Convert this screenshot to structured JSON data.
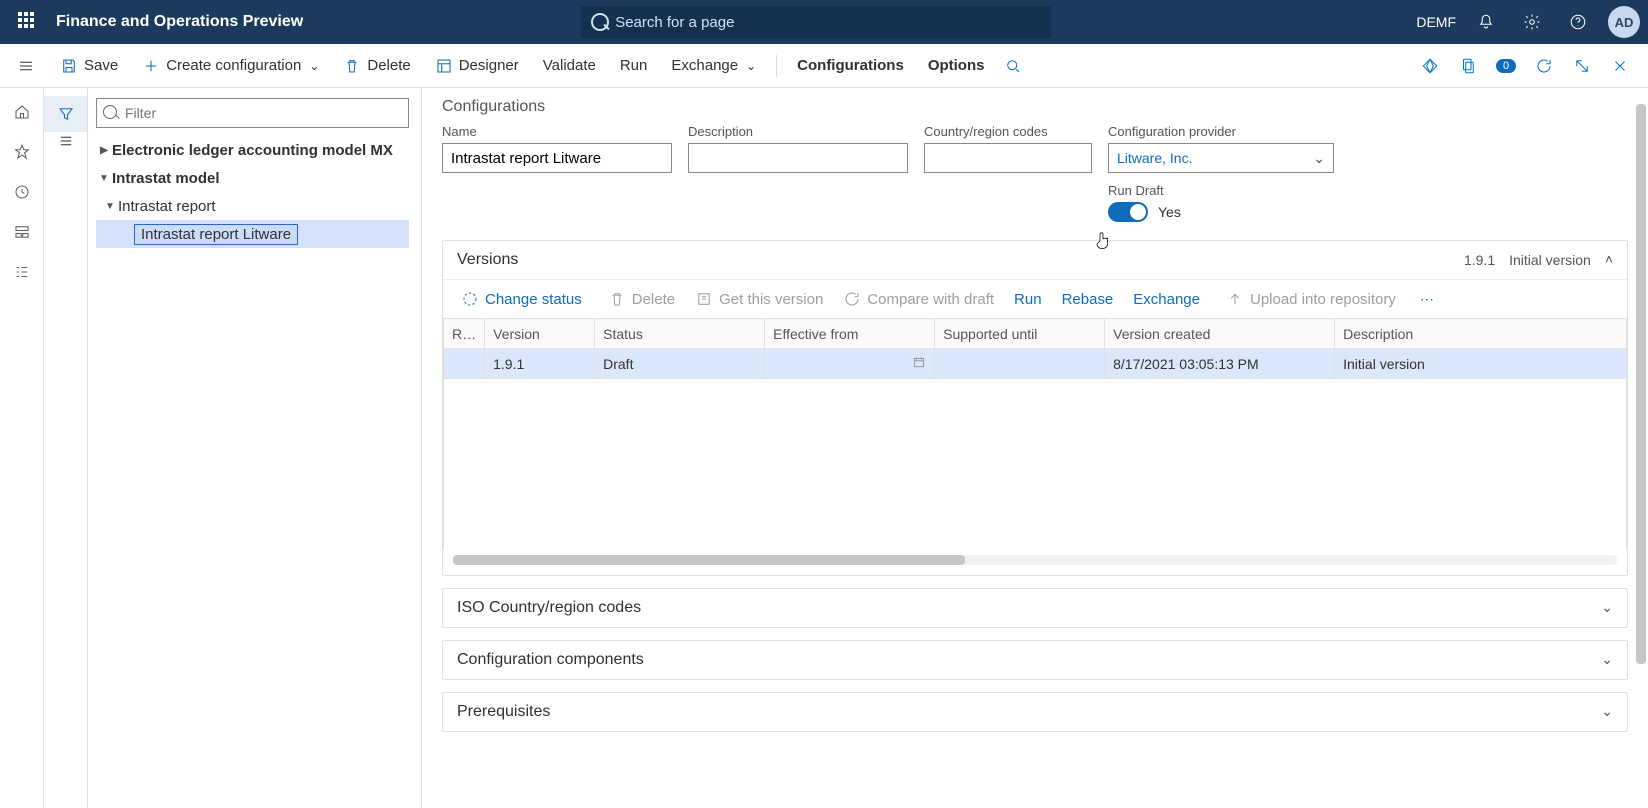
{
  "app": {
    "title": "Finance and Operations Preview",
    "search_placeholder": "Search for a page",
    "company": "DEMF",
    "avatar": "AD"
  },
  "cmd": {
    "save": "Save",
    "create_config": "Create configuration",
    "delete": "Delete",
    "designer": "Designer",
    "validate": "Validate",
    "run": "Run",
    "exchange": "Exchange",
    "configurations": "Configurations",
    "options": "Options",
    "badge": "0"
  },
  "tree": {
    "filter_placeholder": "Filter",
    "items": [
      {
        "label": "Electronic ledger accounting model MX",
        "bold": true,
        "caret": "right",
        "indent": 1
      },
      {
        "label": "Intrastat model",
        "bold": true,
        "caret": "down",
        "indent": 1
      },
      {
        "label": "Intrastat report",
        "bold": false,
        "caret": "down",
        "indent": 2
      },
      {
        "label": "Intrastat report Litware",
        "bold": false,
        "caret": "",
        "indent": 3,
        "selected": true
      }
    ]
  },
  "page": {
    "heading": "Configurations",
    "fields": {
      "name_label": "Name",
      "name_value": "Intrastat report Litware",
      "desc_label": "Description",
      "desc_value": "",
      "country_label": "Country/region codes",
      "country_value": "",
      "provider_label": "Configuration provider",
      "provider_value": "Litware, Inc.",
      "run_draft_label": "Run Draft",
      "run_draft_value": "Yes"
    }
  },
  "versions": {
    "title": "Versions",
    "meta_version": "1.9.1",
    "meta_label": "Initial version",
    "toolbar": {
      "change_status": "Change status",
      "delete": "Delete",
      "get_this_version": "Get this version",
      "compare_with_draft": "Compare with draft",
      "run": "Run",
      "rebase": "Rebase",
      "exchange": "Exchange",
      "upload": "Upload into repository"
    },
    "columns": {
      "r": "R…",
      "version": "Version",
      "status": "Status",
      "effective_from": "Effective from",
      "supported_until": "Supported until",
      "version_created": "Version created",
      "description": "Description"
    },
    "rows": [
      {
        "version": "1.9.1",
        "status": "Draft",
        "effective_from": "",
        "supported_until": "",
        "version_created": "8/17/2021 03:05:13 PM",
        "description": "Initial version"
      }
    ]
  },
  "sections": {
    "iso": "ISO Country/region codes",
    "components": "Configuration components",
    "prereq": "Prerequisites"
  }
}
